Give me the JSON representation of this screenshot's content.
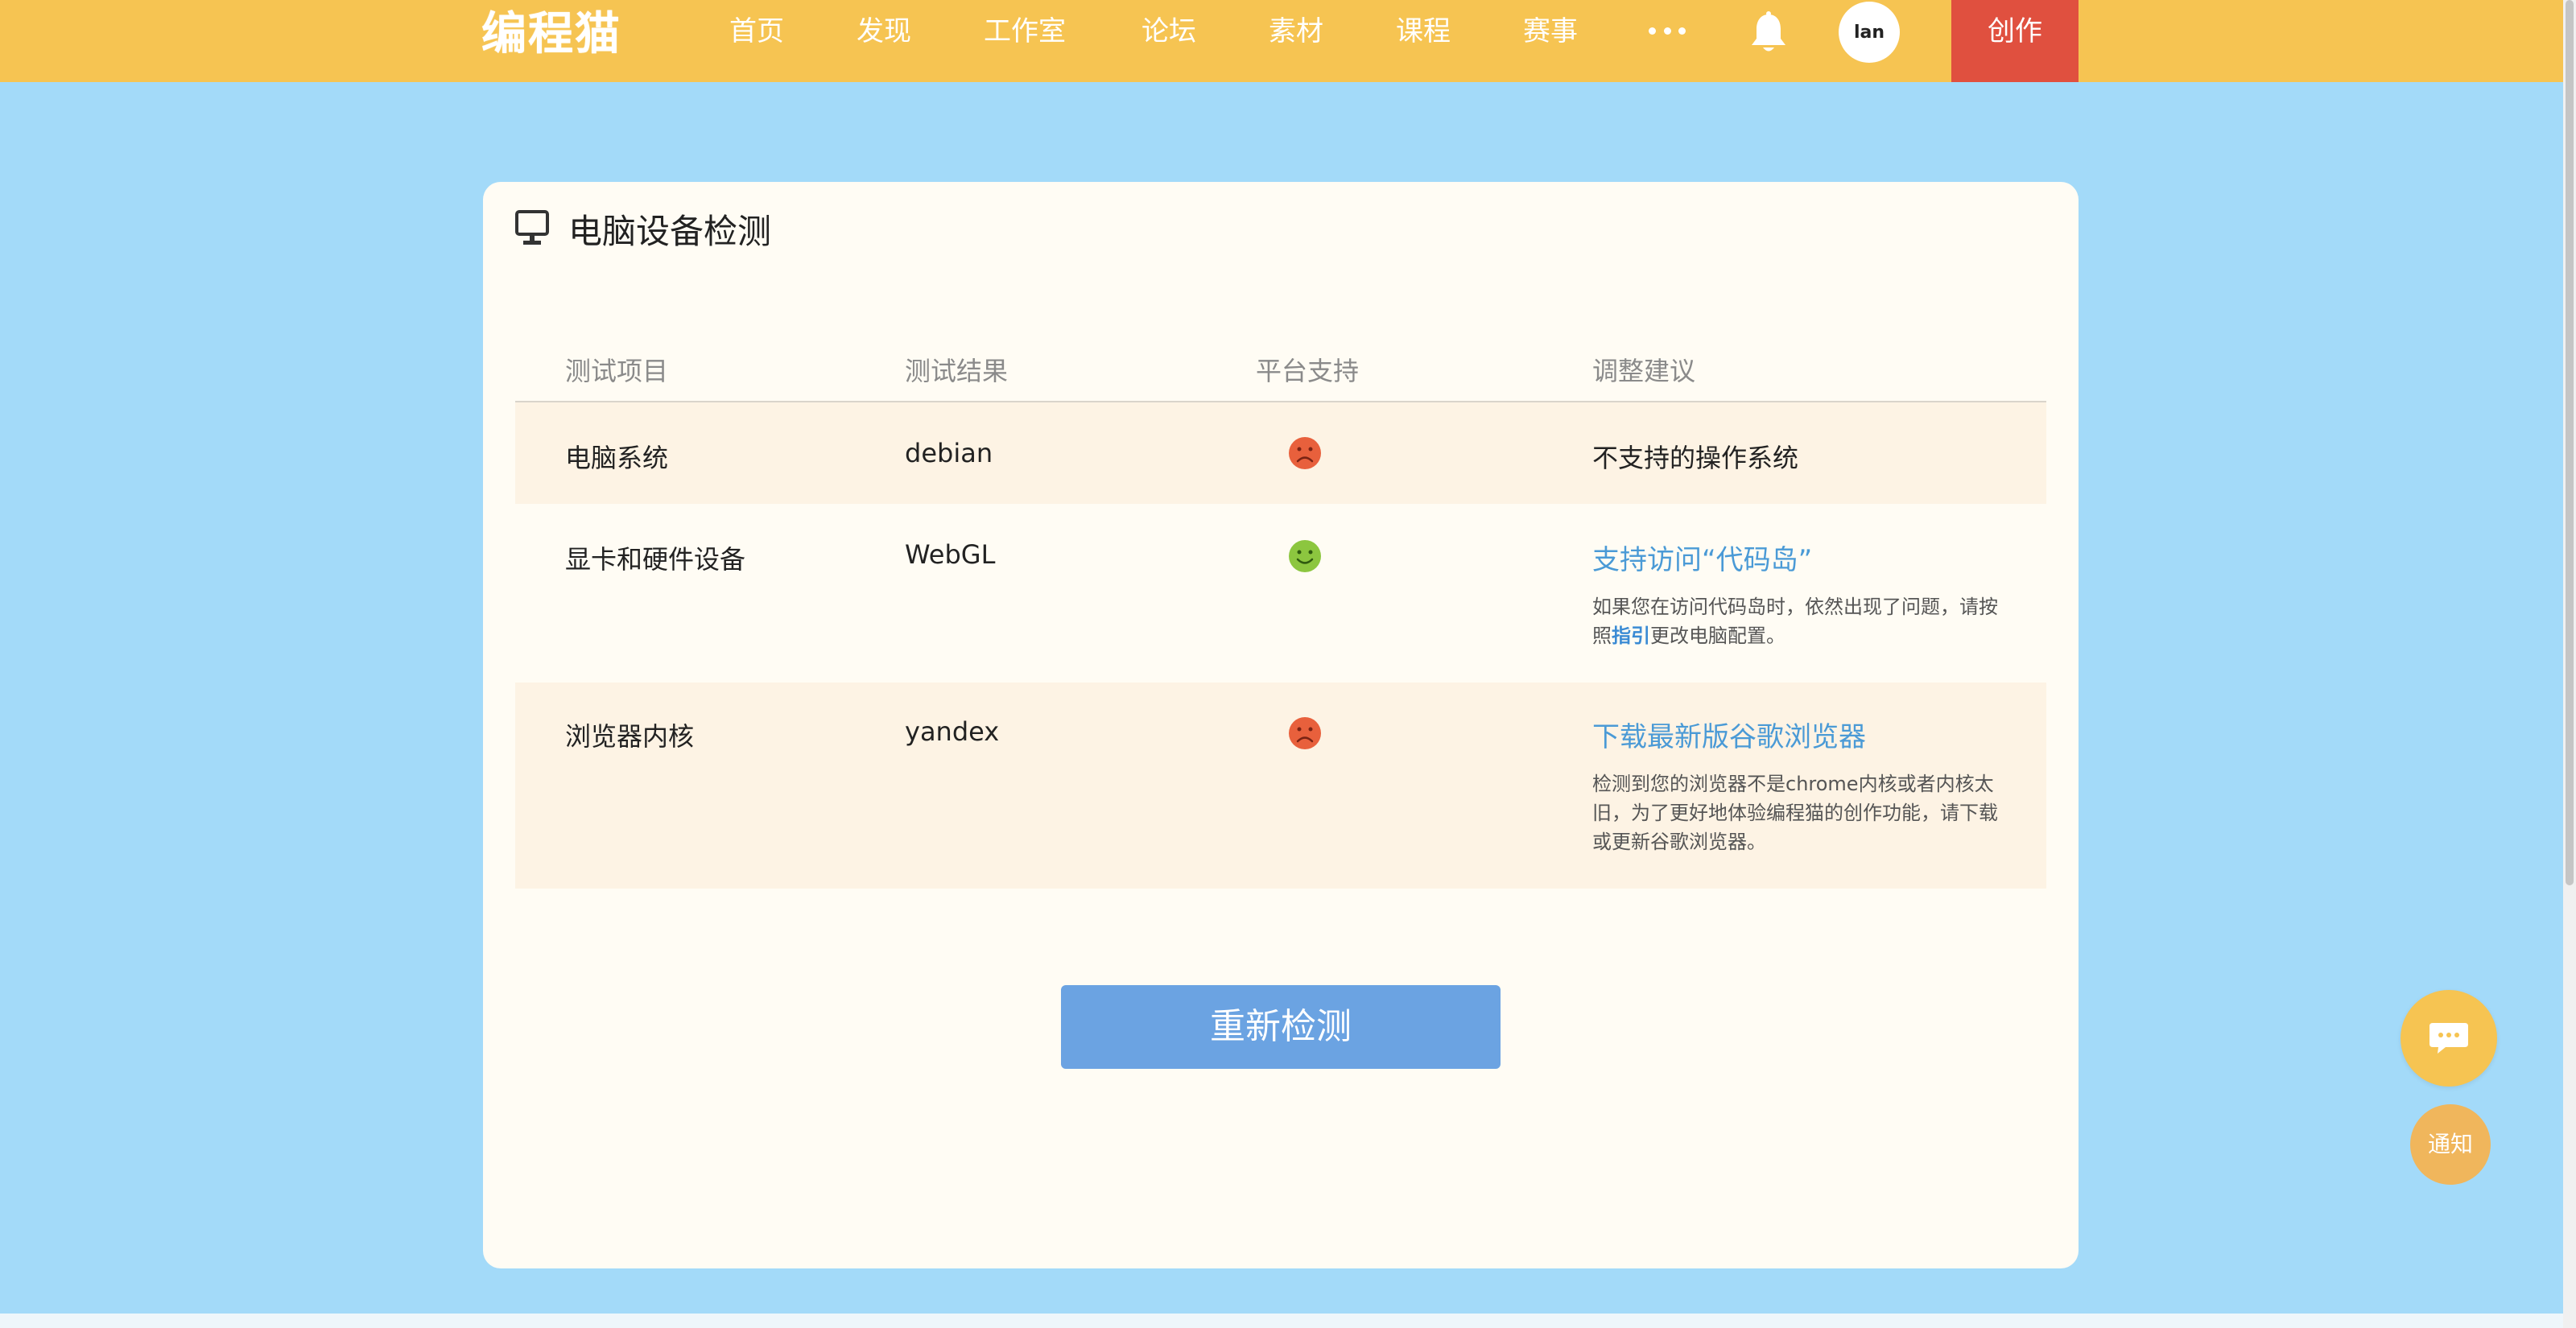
{
  "header": {
    "logo": "编程猫",
    "nav": [
      "首页",
      "发现",
      "工作室",
      "论坛",
      "素材",
      "课程",
      "赛事"
    ],
    "avatar_text": "lan",
    "create_label": "创作"
  },
  "card": {
    "title": "电脑设备检测",
    "columns": [
      "测试项目",
      "测试结果",
      "平台支持",
      "调整建议"
    ],
    "rows": [
      {
        "item": "电脑系统",
        "result": "debian",
        "support": "unsupported",
        "advice": "不支持的操作系统"
      },
      {
        "item": "显卡和硬件设备",
        "result": "WebGL",
        "support": "supported",
        "advice_title": "支持访问“代码岛”",
        "advice_desc_before": "如果您在访问代码岛时，依然出现了问题，请按照",
        "advice_desc_link": "指引",
        "advice_desc_after": "更改电脑配置。"
      },
      {
        "item": "浏览器内核",
        "result": "yandex",
        "support": "unsupported",
        "advice_title": "下载最新版谷歌浏览器",
        "advice_desc": "检测到您的浏览器不是chrome内核或者内核太旧，为了更好地体验编程猫的创作功能，请下载或更新谷歌浏览器。"
      }
    ],
    "recheck_label": "重新检测"
  },
  "floating": {
    "notify_label": "通知"
  },
  "colors": {
    "header_bg": "#f6c452",
    "page_bg": "#a3daf9",
    "create_bg": "#e0503f",
    "link": "#4a9ad6",
    "sad_face": "#e8603c",
    "happy_face": "#8cc63f",
    "button": "#6ba3e2"
  },
  "icons": {
    "monitor": "monitor-icon",
    "bell": "bell-icon",
    "more": "more-icon",
    "sad": "sad-face-icon",
    "happy": "happy-face-icon",
    "chat": "chat-bubble-icon"
  }
}
